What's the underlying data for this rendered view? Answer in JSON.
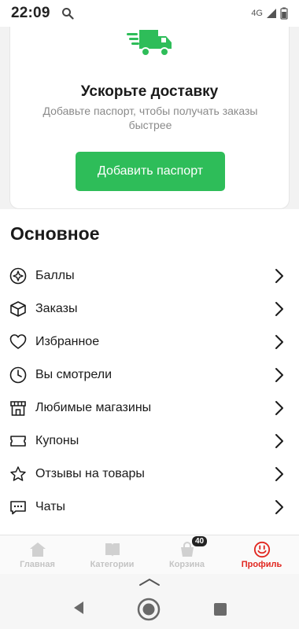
{
  "status_bar": {
    "time": "22:09",
    "network": "4G"
  },
  "promo": {
    "title": "Ускорьте доставку",
    "subtitle": "Добавьте паспорт, чтобы получать заказы быстрее",
    "button_label": "Добавить паспорт"
  },
  "main_section": {
    "title": "Основное",
    "items": [
      {
        "label": "Баллы",
        "icon": "points-icon"
      },
      {
        "label": "Заказы",
        "icon": "box-icon"
      },
      {
        "label": "Избранное",
        "icon": "heart-icon"
      },
      {
        "label": "Вы смотрели",
        "icon": "clock-icon"
      },
      {
        "label": "Любимые магазины",
        "icon": "store-icon"
      },
      {
        "label": "Купоны",
        "icon": "coupon-icon"
      },
      {
        "label": "Отзывы на товары",
        "icon": "star-icon"
      },
      {
        "label": "Чаты",
        "icon": "chat-icon"
      }
    ]
  },
  "bottom_nav": {
    "items": [
      {
        "label": "Главная",
        "icon": "home-icon"
      },
      {
        "label": "Категории",
        "icon": "catalog-icon"
      },
      {
        "label": "Корзина",
        "icon": "cart-icon",
        "badge": "40"
      },
      {
        "label": "Профиль",
        "icon": "profile-icon",
        "active": true
      }
    ]
  },
  "colors": {
    "accent_green": "#2ebd59",
    "active_red": "#e1261f"
  }
}
